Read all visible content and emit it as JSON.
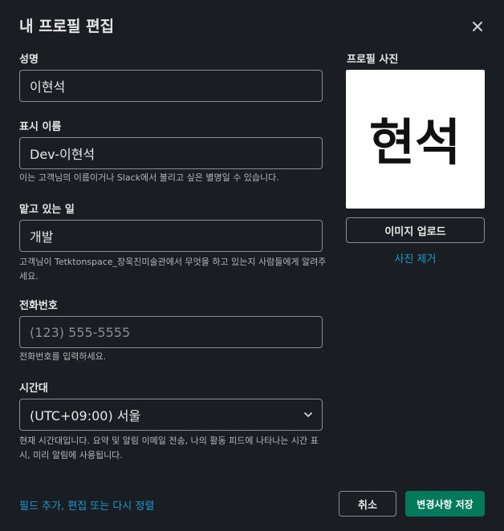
{
  "dialog": {
    "title": "내 프로필 편집",
    "close_icon": "close-icon"
  },
  "fields": {
    "full_name": {
      "label": "성명",
      "value": "이현석"
    },
    "display_name": {
      "label": "표시 이름",
      "value": "Dev-이현석",
      "hint": "이는 고객님의 이름이거나 Slack에서 불리고 싶은 별명일 수 있습니다."
    },
    "role": {
      "label": "맡고 있는 일",
      "value": "개발",
      "hint": "고객님이 Tetktonspace_장욱진미술관에서 무엇을 하고 있는지 사람들에게 알려주세요."
    },
    "phone": {
      "label": "전화번호",
      "placeholder": "(123) 555-5555",
      "hint": "전화번호를 입력하세요."
    },
    "timezone": {
      "label": "시간대",
      "value": "(UTC+09:00) 서울",
      "hint": "현재 시간대입니다. 요약 및 알림 이메일 전송, 나의 활동 피드에 나타나는 시간 표시, 미리 알림에 사용됩니다."
    }
  },
  "photo": {
    "label": "프로필 사진",
    "image_text": "현석",
    "upload_label": "이미지 업로드",
    "remove_label": "사진 제거"
  },
  "footer": {
    "link_label": "필드 추가, 편집 또는 다시 정렬",
    "cancel_label": "취소",
    "save_label": "변경사항 저장"
  },
  "colors": {
    "background": "#1a1d21",
    "accent_link": "#1d9bd1",
    "save_button": "#007a5a"
  }
}
